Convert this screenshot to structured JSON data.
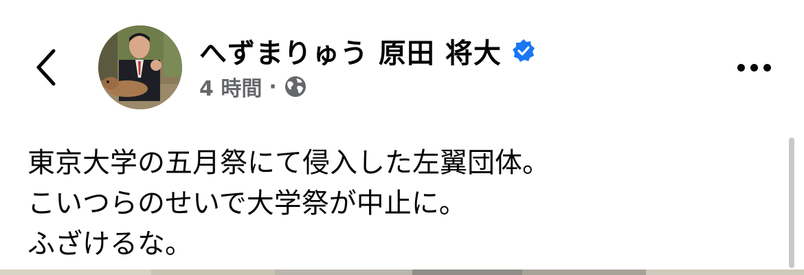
{
  "post": {
    "author_name": "へずまりゅう 原田 将大",
    "verified": true,
    "time": "4 時間",
    "separator": "·",
    "audience_icon": "globe-icon",
    "text_lines": [
      "東京大学の五月祭にて侵入した左翼団体。",
      "こいつらのせいで大学祭が中止に。",
      "ふざけるな。"
    ]
  },
  "icons": {
    "back": "chevron-left-icon",
    "verified": "verified-badge-icon",
    "more": "more-horizontal-icon"
  },
  "colors": {
    "text": "#050505",
    "secondary": "#65676b",
    "verified": "#1877f2"
  }
}
